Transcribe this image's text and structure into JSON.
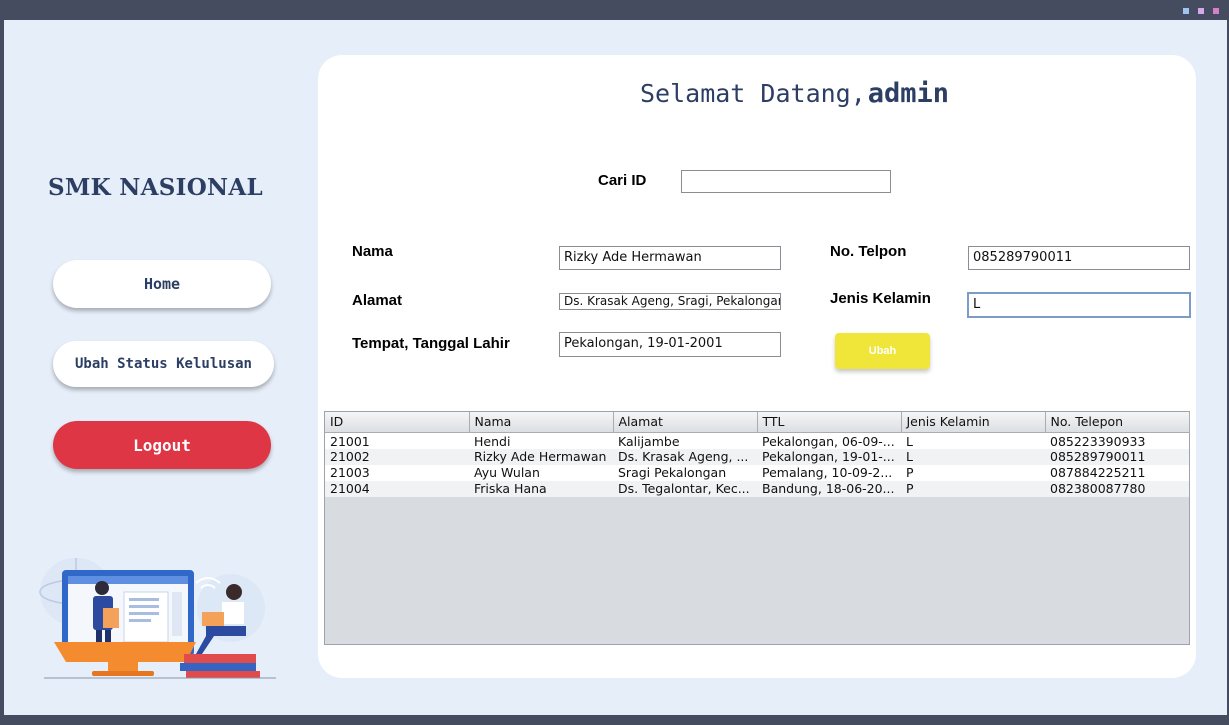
{
  "window": {
    "dot_colors": [
      "#9fc4f0",
      "#d5a9e8",
      "#d97fc8"
    ]
  },
  "sidebar": {
    "brand": "SMK NASIONAL",
    "home_label": "Home",
    "status_label": "Ubah Status Kelulusan",
    "logout_label": "Logout"
  },
  "header": {
    "welcome": "Selamat Datang,",
    "username": "admin"
  },
  "search": {
    "label": "Cari ID",
    "value": ""
  },
  "form": {
    "nama_label": "Nama",
    "nama_value": "Rizky Ade Hermawan",
    "alamat_label": "Alamat",
    "alamat_value": "Ds. Krasak Ageng, Sragi, Pekalongan",
    "ttl_label": "Tempat, Tanggal Lahir",
    "ttl_value": "Pekalongan, 19-01-2001",
    "telpon_label": "No. Telpon",
    "telpon_value": "085289790011",
    "jk_label": "Jenis Kelamin",
    "jk_value": "L",
    "ubah_label": "Ubah"
  },
  "table": {
    "columns": [
      "ID",
      "Nama",
      "Alamat",
      "TTL",
      "Jenis Kelamin",
      "No. Telepon"
    ],
    "rows": [
      [
        "21001",
        "Hendi",
        "Kalijambe",
        "Pekalongan, 06-09-...",
        "L",
        "085223390933"
      ],
      [
        "21002",
        "Rizky Ade Hermawan",
        "Ds. Krasak Ageng, ...",
        "Pekalongan, 19-01-...",
        "L",
        "085289790011"
      ],
      [
        "21003",
        "Ayu Wulan",
        "Sragi Pekalongan",
        "Pemalang, 10-09-2...",
        "P",
        "087884225211"
      ],
      [
        "21004",
        "Friska Hana",
        "Ds. Tegalontar, Kec...",
        "Bandung, 18-06-20...",
        "P",
        "082380087780"
      ]
    ]
  },
  "colors": {
    "brand": "#2c3e63",
    "logout": "#df3646",
    "ubah": "#f0e63a",
    "background": "#e6eef9",
    "frame": "#454c60"
  }
}
